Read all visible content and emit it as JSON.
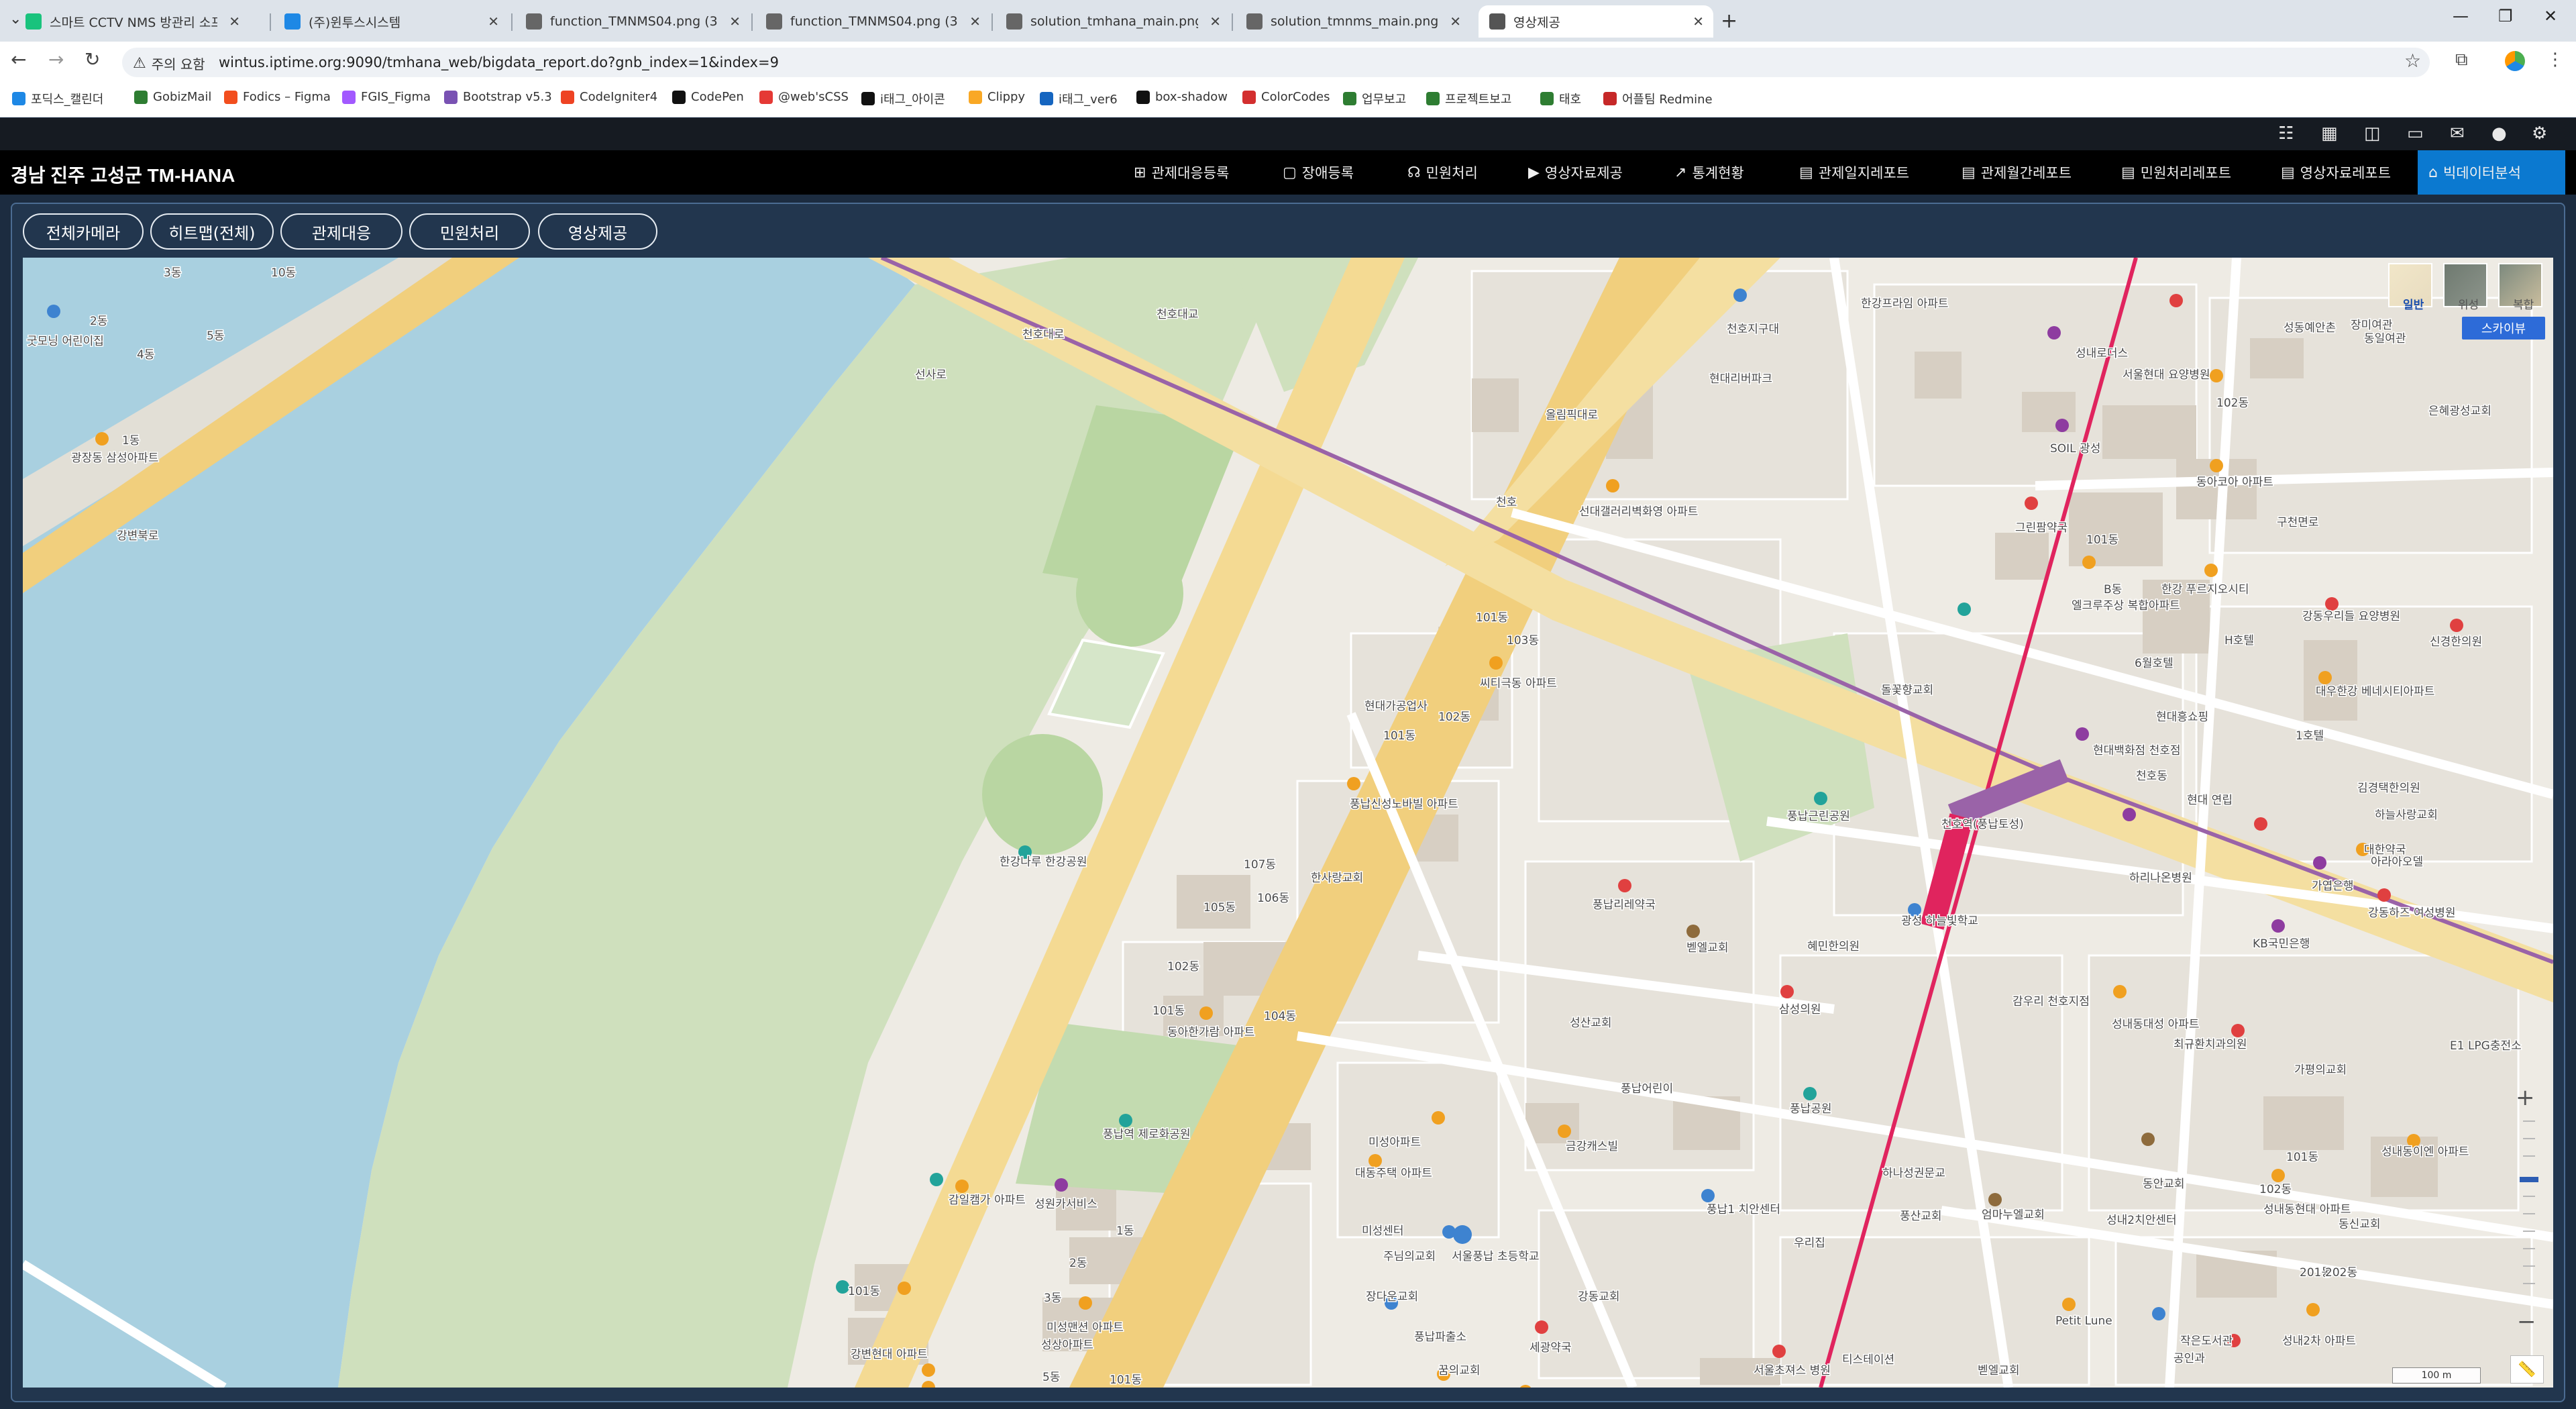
{
  "browser": {
    "tabs": [
      {
        "title": "스마트 CCTV NMS 방관리 소프",
        "color": "#19c37d"
      },
      {
        "title": "(주)윈투스시스템",
        "color": "#1e88e5"
      },
      {
        "title": "function_TMNMS04.png (360×",
        "color": "#666666"
      },
      {
        "title": "function_TMNMS04.png (360×",
        "color": "#666666"
      },
      {
        "title": "solution_tmhana_main.png (72",
        "color": "#666666"
      },
      {
        "title": "solution_tmnms_main.png (72",
        "color": "#666666"
      },
      {
        "title": "영상제공",
        "color": "#555555",
        "active": true
      }
    ],
    "security_label": "주의 요함",
    "url": "wintus.iptime.org:9090/tmhana_web/bigdata_report.do?gnb_index=1&index=9",
    "bookmarks": [
      {
        "label": "포딕스_캘린더",
        "color": "#1e88e5"
      },
      {
        "label": "GobizMail",
        "color": "#2e7d32"
      },
      {
        "label": "Fodics – Figma",
        "color": "#f24e1e"
      },
      {
        "label": "FGIS_Figma",
        "color": "#a259ff"
      },
      {
        "label": "Bootstrap v5.3",
        "color": "#7952b3"
      },
      {
        "label": "CodeIgniter4",
        "color": "#ee4323"
      },
      {
        "label": "CodePen",
        "color": "#111111"
      },
      {
        "label": "@web'sCSS",
        "color": "#e53935"
      },
      {
        "label": "i태그_아이콘",
        "color": "#111111"
      },
      {
        "label": "Clippy",
        "color": "#f9a825"
      },
      {
        "label": "i태그_ver6",
        "color": "#1565c0"
      },
      {
        "label": "box-shadow",
        "color": "#111111"
      },
      {
        "label": "ColorCodes",
        "color": "#d32f2f"
      },
      {
        "label": "업무보고",
        "color": "#2e7d32"
      },
      {
        "label": "프로젝트보고",
        "color": "#2e7d32"
      },
      {
        "label": "태호",
        "color": "#2e7d32"
      },
      {
        "label": "어플팀 Redmine",
        "color": "#c62828"
      }
    ]
  },
  "app": {
    "title": "경남 진주 고성군 TM-HANA",
    "menu": [
      {
        "label": "관제대응등록",
        "icon": "⊞"
      },
      {
        "label": "장애등록",
        "icon": "▢"
      },
      {
        "label": "민원처리",
        "icon": "☊"
      },
      {
        "label": "영상자료제공",
        "icon": "▶"
      },
      {
        "label": "통계현황",
        "icon": "↗"
      },
      {
        "label": "관제일지레포트",
        "icon": "▤"
      },
      {
        "label": "관제월간레포트",
        "icon": "▤"
      },
      {
        "label": "민원처리레포트",
        "icon": "▤"
      },
      {
        "label": "영상자료레포트",
        "icon": "▤"
      },
      {
        "label": "빅데이터분석",
        "icon": "⌂",
        "active": true
      }
    ],
    "filters": [
      "전체카메라",
      "히트맵(전체)",
      "관제대응",
      "민원처리",
      "영상제공"
    ]
  },
  "map": {
    "type_buttons": [
      "일반",
      "위성",
      "복합"
    ],
    "skyview_label": "스카이뷰",
    "scale_label": "100 m",
    "colors": {
      "water": "#a9d0e0",
      "land": "#eeebe4",
      "park": "#cfe0bd",
      "highway": "#f1cf7d",
      "road": "#f6f4ef",
      "block": "#e6e2da",
      "subway_pink": "#e0245e",
      "subway_purple": "#9a63a8"
    },
    "labels": [
      {
        "text": "3동"
      },
      {
        "text": "10동"
      },
      {
        "text": "2동"
      },
      {
        "text": "5동"
      },
      {
        "text": "4동"
      },
      {
        "text": "굿모닝 어린이집"
      },
      {
        "text": "1동"
      },
      {
        "text": "광장동 삼성아파트"
      },
      {
        "text": "강변북로"
      },
      {
        "text": "천호대교"
      },
      {
        "text": "올림픽대로"
      },
      {
        "text": "천호"
      },
      {
        "text": "선대갤러리벽화영 아파트"
      },
      {
        "text": "천호지구대"
      },
      {
        "text": "현대리버파크"
      },
      {
        "text": "한강프라임 아파트"
      },
      {
        "text": "성내로더스"
      },
      {
        "text": "서울현대 요양병원"
      },
      {
        "text": "성동예안촌"
      },
      {
        "text": "102동"
      },
      {
        "text": "동일여관"
      },
      {
        "text": "장미여관"
      },
      {
        "text": "은혜광성교회"
      },
      {
        "text": "SOIL 광성"
      },
      {
        "text": "동아코아 아파트"
      },
      {
        "text": "그린팜약국"
      },
      {
        "text": "101동"
      },
      {
        "text": "B동"
      },
      {
        "text": "한강 푸르지오시티"
      },
      {
        "text": "엘크루주상 복합아파트"
      },
      {
        "text": "강동우리들 요양병원"
      },
      {
        "text": "신경한의원"
      },
      {
        "text": "H호텔"
      },
      {
        "text": "6월호텔"
      },
      {
        "text": "대우한강 베네시티아파트"
      },
      {
        "text": "101동"
      },
      {
        "text": "103동"
      },
      {
        "text": "씨티극동 아파트"
      },
      {
        "text": "현대가공업사"
      },
      {
        "text": "102동"
      },
      {
        "text": "101동"
      },
      {
        "text": "풍납신성노바빌 아파트"
      },
      {
        "text": "돌꽃향교회"
      },
      {
        "text": "현대흥쇼핑"
      },
      {
        "text": "1호텔"
      },
      {
        "text": "현대백화점 천호점"
      },
      {
        "text": "천호동"
      },
      {
        "text": "현대 연립"
      },
      {
        "text": "김경택한의원"
      },
      {
        "text": "하늘사랑교회"
      },
      {
        "text": "대한약국"
      },
      {
        "text": "가엽은행"
      },
      {
        "text": "아라아오델"
      },
      {
        "text": "강동하즈 여성병원"
      },
      {
        "text": "풍납근린공원"
      },
      {
        "text": "하리나온병원"
      },
      {
        "text": "KB국민은행"
      },
      {
        "text": "E1 LPG충전소"
      },
      {
        "text": "107동"
      },
      {
        "text": "105동"
      },
      {
        "text": "106동"
      },
      {
        "text": "한사랑교회"
      },
      {
        "text": "풍납리레약국"
      },
      {
        "text": "광성 하늘빛학교"
      },
      {
        "text": "벧엘교회"
      },
      {
        "text": "혜민한의원"
      },
      {
        "text": "한강나루 한강공원"
      },
      {
        "text": "102동"
      },
      {
        "text": "101동"
      },
      {
        "text": "동아한가람 아파트"
      },
      {
        "text": "104동"
      },
      {
        "text": "삼성의원"
      },
      {
        "text": "감우리 천호지점"
      },
      {
        "text": "성내동대성 아파트"
      },
      {
        "text": "최규환치과의원"
      },
      {
        "text": "성산교회"
      },
      {
        "text": "가평의교회"
      },
      {
        "text": "풍납어린이"
      },
      {
        "text": "풍납역 제로화공원"
      },
      {
        "text": "금강캐스빌"
      },
      {
        "text": "풍납공원"
      },
      {
        "text": "미성아파트"
      },
      {
        "text": "대동주택 아파트"
      },
      {
        "text": "풍납1 치안센터"
      },
      {
        "text": "우리집"
      },
      {
        "text": "풍산교회"
      },
      {
        "text": "엄마누엘교회"
      },
      {
        "text": "성내2치안센터"
      },
      {
        "text": "동안교회"
      },
      {
        "text": "성내동이엔 아파트"
      },
      {
        "text": "101동"
      },
      {
        "text": "102동"
      },
      {
        "text": "성내동현대 아파트"
      },
      {
        "text": "동신교회"
      },
      {
        "text": "감일캠가 아파트"
      },
      {
        "text": "성원카서비스"
      },
      {
        "text": "1동"
      },
      {
        "text": "2동"
      },
      {
        "text": "3동"
      },
      {
        "text": "미성맨션 아파트"
      },
      {
        "text": "미성센터"
      },
      {
        "text": "주님의교회"
      },
      {
        "text": "장다운교회"
      },
      {
        "text": "서울풍납 초등학교"
      },
      {
        "text": "강동교회"
      },
      {
        "text": "풍납파출소"
      },
      {
        "text": "성상아파트"
      },
      {
        "text": "세광약국"
      },
      {
        "text": "꿈의교회"
      },
      {
        "text": "101동"
      },
      {
        "text": "강변현대 아파트"
      },
      {
        "text": "5동"
      },
      {
        "text": "101동"
      },
      {
        "text": "서울초져스 병원"
      },
      {
        "text": "티스테이션"
      },
      {
        "text": "벧엘교회"
      },
      {
        "text": "Petit Lune"
      },
      {
        "text": "작은도서관"
      },
      {
        "text": "공인과"
      },
      {
        "text": "201동"
      },
      {
        "text": "202동"
      },
      {
        "text": "성내2차 아파트"
      },
      {
        "text": "하나성권문교"
      },
      {
        "text": "선사로"
      },
      {
        "text": "천호역(풍납토성)"
      },
      {
        "text": "천호대로"
      },
      {
        "text": "구천면로"
      }
    ]
  }
}
